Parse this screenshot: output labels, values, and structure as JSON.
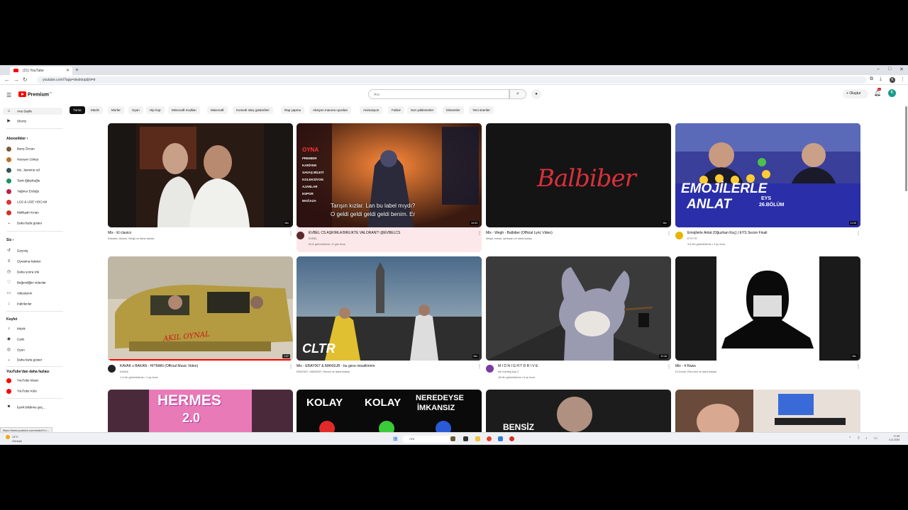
{
  "browser": {
    "tab_title": "(21) YouTube",
    "url": "youtube.com/?app=desktop&hl=tr"
  },
  "header": {
    "logo_text": "Premium",
    "logo_suffix": "TR",
    "search_placeholder": "Ara",
    "create_label": "Oluştur",
    "notification_count": "9+",
    "user_initial": "K"
  },
  "chips": [
    "Tümü",
    "Müzik",
    "Mix'ler",
    "Oyun",
    "Hip hop",
    "Minecraft modları",
    "Minecraft",
    "Komedi skeç gösterileri",
    "Rap yapma",
    "Aksiyon macera oyunları",
    "Animasyon",
    "Futbol",
    "Son yüklenenler",
    "İzlenenler",
    "Yeni öneriler"
  ],
  "sidebar": {
    "home": "Ana Sayfa",
    "shorts": "Shorts",
    "subscriptions_head": "Abonelikler",
    "subscriptions": [
      {
        "name": "Barış Özcan",
        "color": "#7a5a3a"
      },
      {
        "name": "Hacıyev Gökçe",
        "color": "#b8732a"
      },
      {
        "name": "Ms. Jasmine ecl",
        "color": "#355"
      },
      {
        "name": "Tarık İğbiyikoğlu",
        "color": "#1f8f5f"
      },
      {
        "name": "Yağmur Erdoğu",
        "color": "#c02040"
      },
      {
        "name": "LGS & LİSE HOCAM",
        "color": "#e03030"
      },
      {
        "name": "Melikşah Kınan",
        "color": "#d0302a"
      }
    ],
    "more_subs": "Daha fazla göster",
    "you_head": "Siz",
    "you_items": [
      "Geçmiş",
      "Oynatma listeleri",
      "Daha sonra izle",
      "Beğendiğim videolar",
      "Videolarım",
      "İndirilenler"
    ],
    "explore_head": "Keşfet",
    "explore_items": [
      "Müzik",
      "Canlı",
      "Oyun"
    ],
    "more_explore": "Daha fazla göster",
    "more_from_head": "YouTube'dan daha fazlası",
    "more_from_items": [
      "YouTube Music",
      "YouTube Kids"
    ],
    "report": "İçerik bildirme geç..."
  },
  "videos": [
    {
      "title": "Mix - El clasico",
      "meta": "Kökalan, Alioolo, Wegh ve daha fazlası",
      "meta2": "",
      "badge": "Mix",
      "avatar": ""
    },
    {
      "title": "EVBEL CS AŞKIMLA BİRLİKTE VALORANT! @EVBELCS",
      "meta": "EVBEL",
      "meta2": "54 B görüntüleme • 5 gün önce",
      "badge": "34:53",
      "avatar": "#5a2a2a"
    },
    {
      "title": "Mix - Wegh - Balbiber (Official Lyric Video)",
      "meta": "Wegh, elmas, şehirşah ve daha fazlası",
      "meta2": "",
      "badge": "Mix",
      "avatar": ""
    },
    {
      "title": "Emojilerle Anlat (Oğuzhan Koç) | EYS Sezon Finali",
      "meta": "EYS TR",
      "meta2": "3,5 Mn görüntüleme • 3 yıl önce",
      "badge": "11:06",
      "avatar": "#e8b400"
    },
    {
      "title": "KAVAK x BAKAN - HITMAN (Official Music Video)",
      "meta": "KAVAK",
      "meta2": "1,4 Mn görüntüleme • 1 ay önce",
      "badge": "1:37",
      "avatar": "#222"
    },
    {
      "title": "Mix - ERAY067 & MANSUR - bu gece misafirimim",
      "meta": "ERAY067, MANSUR, Reckol ve daha fazlası",
      "meta2": "",
      "badge": "Mix",
      "avatar": ""
    },
    {
      "title": "M I D N I G H T   D R I V E",
      "meta": "the bootleg boy 2",
      "meta2": "18 Mn görüntüleme • 6 yıl önce",
      "badge": "22:46",
      "avatar": "#7a3aa0"
    },
    {
      "title": "Mix - 4 Raws",
      "meta": "Dr.Doruk, Rico Asıl ve daha fazlası",
      "meta2": "",
      "badge": "Mix",
      "avatar": ""
    },
    {
      "title": "",
      "meta": "",
      "meta2": "",
      "badge": "",
      "avatar": ""
    },
    {
      "title": "",
      "meta": "",
      "meta2": "",
      "badge": "",
      "avatar": ""
    },
    {
      "title": "",
      "meta": "",
      "meta2": "",
      "badge": "",
      "avatar": ""
    },
    {
      "title": "",
      "meta": "",
      "meta2": "",
      "badge": "",
      "avatar": ""
    }
  ],
  "thumb_text": {
    "t2_menu": [
      "OYNA",
      "PREMIER",
      "KARİYER",
      "SAVAŞ BİLETİ",
      "KOLEKSİYON",
      "AJANLAR",
      "ESPOR",
      "MAĞAZA"
    ],
    "t2_caption1": "Tarışın kızlar. Lan bu label mıydı?",
    "t2_caption2": "O geldi geldi geldi geldi benim. Er",
    "t3_script": "Balbiber",
    "t4_line1": "EMOJİLERLE",
    "t4_line2": "ANLAT",
    "t4_badge1": "EYS",
    "t4_badge2": "26.BÖLÜM",
    "t5_signature": "AKIL OYNAL",
    "t6_logo": "CLTR",
    "t9_text": "HERMES",
    "t9_sub": "2.0",
    "t10_words": [
      "KOLAY",
      "KOLAY",
      "NEREDEYSE",
      "İMKANSIZ"
    ],
    "t11_text": "BENSİZ"
  },
  "statusbar": {
    "url": "https://www.youtube.com/watch?v=..."
  },
  "taskbar": {
    "weather_temp": "14°C",
    "weather_desc": "Güneşli",
    "search": "Ara",
    "time": "17:05",
    "date": "4.11.2024"
  }
}
